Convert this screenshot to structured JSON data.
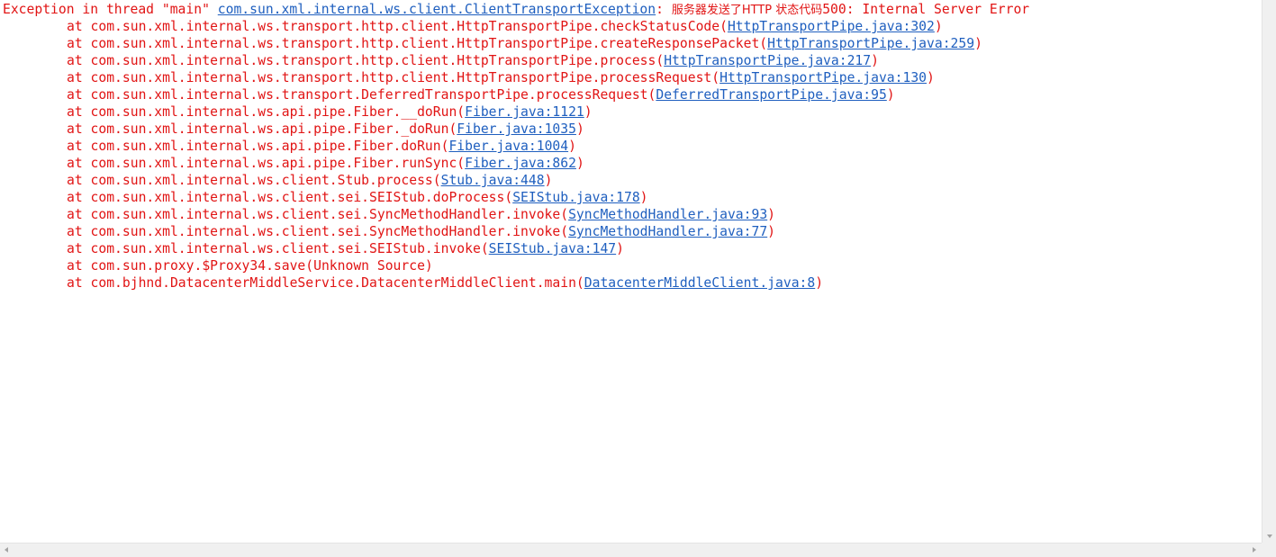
{
  "exception": {
    "prefix": "Exception in thread \"main\" ",
    "class_link": "com.sun.xml.internal.ws.client.ClientTransportException",
    "colon": ": ",
    "message_cjk": "服务器发送了HTTP 状态代码",
    "message_rest": "500: Internal Server Error"
  },
  "frames": [
    {
      "method": "at com.sun.xml.internal.ws.transport.http.client.HttpTransportPipe.checkStatusCode(",
      "location": "HttpTransportPipe.java:302",
      "close": ")"
    },
    {
      "method": "at com.sun.xml.internal.ws.transport.http.client.HttpTransportPipe.createResponsePacket(",
      "location": "HttpTransportPipe.java:259",
      "close": ")"
    },
    {
      "method": "at com.sun.xml.internal.ws.transport.http.client.HttpTransportPipe.process(",
      "location": "HttpTransportPipe.java:217",
      "close": ")"
    },
    {
      "method": "at com.sun.xml.internal.ws.transport.http.client.HttpTransportPipe.processRequest(",
      "location": "HttpTransportPipe.java:130",
      "close": ")"
    },
    {
      "method": "at com.sun.xml.internal.ws.transport.DeferredTransportPipe.processRequest(",
      "location": "DeferredTransportPipe.java:95",
      "close": ")"
    },
    {
      "method": "at com.sun.xml.internal.ws.api.pipe.Fiber.__doRun(",
      "location": "Fiber.java:1121",
      "close": ")"
    },
    {
      "method": "at com.sun.xml.internal.ws.api.pipe.Fiber._doRun(",
      "location": "Fiber.java:1035",
      "close": ")"
    },
    {
      "method": "at com.sun.xml.internal.ws.api.pipe.Fiber.doRun(",
      "location": "Fiber.java:1004",
      "close": ")"
    },
    {
      "method": "at com.sun.xml.internal.ws.api.pipe.Fiber.runSync(",
      "location": "Fiber.java:862",
      "close": ")"
    },
    {
      "method": "at com.sun.xml.internal.ws.client.Stub.process(",
      "location": "Stub.java:448",
      "close": ")"
    },
    {
      "method": "at com.sun.xml.internal.ws.client.sei.SEIStub.doProcess(",
      "location": "SEIStub.java:178",
      "close": ")"
    },
    {
      "method": "at com.sun.xml.internal.ws.client.sei.SyncMethodHandler.invoke(",
      "location": "SyncMethodHandler.java:93",
      "close": ")"
    },
    {
      "method": "at com.sun.xml.internal.ws.client.sei.SyncMethodHandler.invoke(",
      "location": "SyncMethodHandler.java:77",
      "close": ")"
    },
    {
      "method": "at com.sun.xml.internal.ws.client.sei.SEIStub.invoke(",
      "location": "SEIStub.java:147",
      "close": ")"
    },
    {
      "method": "at com.sun.proxy.$Proxy34.save(Unknown Source)",
      "location": "",
      "close": ""
    },
    {
      "method": "at com.bjhnd.DatacenterMiddleService.DatacenterMiddleClient.main(",
      "location": "DatacenterMiddleClient.java:8",
      "close": ")"
    }
  ],
  "colors": {
    "error_text": "#e11414",
    "link": "#1f5fbf",
    "background": "#ffffff"
  },
  "scrollbars": {
    "vertical_icon": "chevron-down-icon",
    "horizontal_left_icon": "chevron-left-icon",
    "horizontal_right_icon": "chevron-right-icon"
  }
}
